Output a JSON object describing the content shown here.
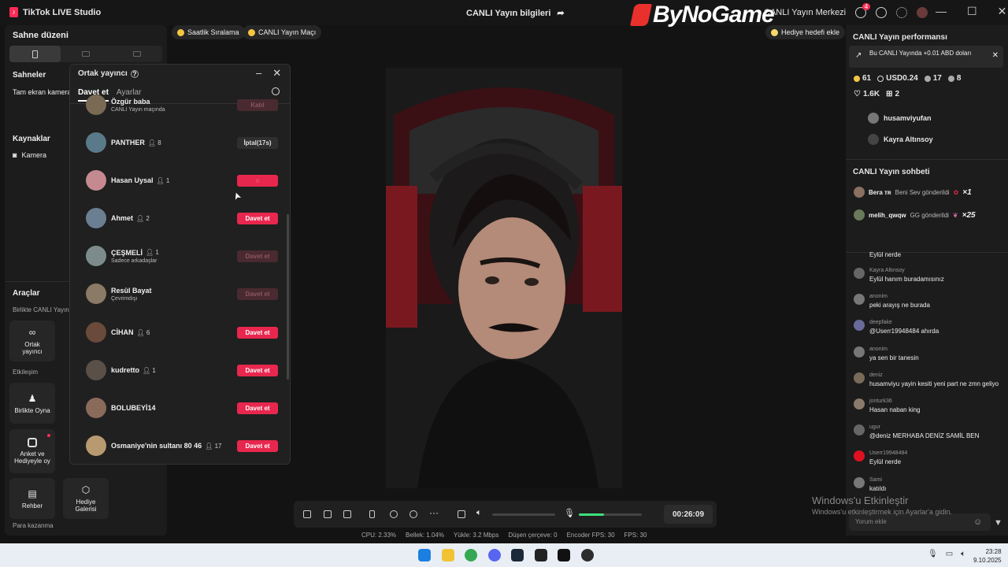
{
  "titlebar": {
    "app_name": "TikTok LIVE Studio",
    "center_title": "CANLI Yayın bilgileri",
    "watermark": "ByNoGame",
    "live_center": "CANLI Yayın Merkezi",
    "notif_count": "4"
  },
  "left": {
    "scene_layout": "Sahne düzeni",
    "scenes": "Sahneler",
    "scene_item": "Tam ekran kamera",
    "sources": "Kaynaklar",
    "source_camera": "Kamera",
    "tools": "Araçlar",
    "tools_sub": "Birlikte CANLI Yayın",
    "co_host": "Ortak yayıncı",
    "interaction": "Etkileşim",
    "play_together": "Birlikte Oyna",
    "poll": "Anket ve Hediyeyle oy",
    "guide": "Rehber",
    "gift_gallery": "Hediye Galerisi",
    "monetize": "Para kazanma"
  },
  "pills": {
    "hourly": "Saatlik Sıralama",
    "match": "CANLI Yayın Maçı",
    "gift_goal": "Hediye hedefi ekle"
  },
  "dialog": {
    "title": "Ortak yayıncı",
    "tab_invite": "Davet et",
    "tab_settings": "Ayarlar",
    "rows": [
      {
        "name": "Özgür baba",
        "sub": "CANLI Yayın maçında",
        "count": "",
        "button": "Katıl",
        "style": "dim",
        "avatar": "#7a6a55"
      },
      {
        "name": "PANTHER",
        "sub": "",
        "count": "8",
        "button": "İptal(17s)",
        "style": "gray",
        "avatar": "#5a7a8a"
      },
      {
        "name": "Hasan Uysal",
        "sub": "",
        "count": "1",
        "button": "",
        "style": "red",
        "avatar": "#c48a90"
      },
      {
        "name": "Ahmet",
        "sub": "",
        "count": "2",
        "button": "Davet et",
        "style": "red",
        "avatar": "#6b7f92"
      },
      {
        "name": "ÇEŞMELİ",
        "sub": "Sadece arkadaşlar",
        "count": "1",
        "button": "Davet et",
        "style": "dim",
        "avatar": "#7c8c8c"
      },
      {
        "name": "Resûl Bayat",
        "sub": "Çevrimdışı",
        "count": "",
        "button": "Davet et",
        "style": "dim",
        "avatar": "#8a7a66"
      },
      {
        "name": "CİHAN",
        "sub": "",
        "count": "6",
        "button": "Davet et",
        "style": "red",
        "avatar": "#6a4a3a"
      },
      {
        "name": "kudretto",
        "sub": "",
        "count": "1",
        "button": "Davet et",
        "style": "red",
        "avatar": "#5a5048"
      },
      {
        "name": "BOLUBEYİ14",
        "sub": "",
        "count": "",
        "button": "Davet et",
        "style": "red",
        "avatar": "#8a6a5a"
      },
      {
        "name": "Osmaniye'nin sultanı 80 46",
        "sub": "",
        "count": "17",
        "button": "Davet et",
        "style": "red",
        "avatar": "#b89a70"
      }
    ]
  },
  "toolbar": {
    "timer": "00:26:09",
    "mic_level": 0.4
  },
  "stats": {
    "cpu": "CPU: 2.33%",
    "mem": "Bellek: 1.04%",
    "upload": "Yükle: 3.2 Mbps",
    "dropped": "Düşen çerçeve: 0",
    "enc_fps": "Encoder FPS: 30",
    "fps": "FPS: 30"
  },
  "right": {
    "perf_title": "CANLI Yayın performansı",
    "notice": "Bu CANLI Yayında +0.01 ABD doları",
    "coins": "61",
    "usd": "USD0.24",
    "viewers": "17",
    "new": "8",
    "likes": "1.6K",
    "gifts": "2",
    "viewer1": "husamviyufan",
    "viewer2": "Kayra Altınsoy",
    "chat_title": "CANLI Yayın sohbeti",
    "gift1_user": "Bera ᴛʀ",
    "gift1_msg": "Beni Sev gönderildi",
    "gift1_count": "×1",
    "gift2_user": "melih_qwqw",
    "gift2_msg": "GG gönderildi",
    "gift2_count": "×25",
    "messages": [
      {
        "name": "",
        "text": "Eylül nerde"
      },
      {
        "name": "Kayra Altınsoy",
        "text": "Eylül hanım buradamısınız"
      },
      {
        "name": "anonim",
        "text": "peki arayış ne burada"
      },
      {
        "name": "deepfake",
        "text": "@Userr19948484 ahırda"
      },
      {
        "name": "anonim",
        "text": "ya sen bir tanesin"
      },
      {
        "name": "deniz",
        "text": "husamviyu yayin kesiti yeni part ne zmn geliyo"
      },
      {
        "name": "jonturk36",
        "text": "Hasan naban king"
      },
      {
        "name": "ugur",
        "text": "@deniz MERHABA DENİZ SAMİL BEN"
      },
      {
        "name": "Userr19948484",
        "text": "Eylül nerde"
      },
      {
        "name": "Sami",
        "text": "katıldı"
      }
    ],
    "input_placeholder": "Yorum ekle"
  },
  "windows": {
    "activate": "Windows'u Etkinleştir",
    "activate_sub": "Windows'u etkinleştirmek için Ayarlar'a gidin.",
    "time": "23:28",
    "date": "9.10.2025"
  },
  "colors": {
    "accent": "#fe2c55",
    "button": "#e8274e"
  }
}
